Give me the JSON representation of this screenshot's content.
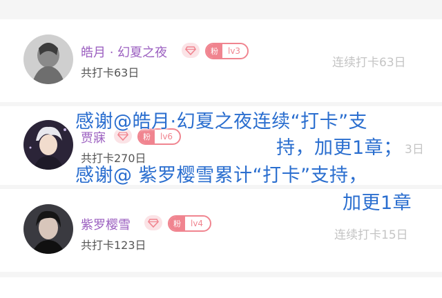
{
  "rows": [
    {
      "username": "皓月 · 幻夏之夜",
      "fan_tag": "粉",
      "level": "lv3",
      "total_checkin": "共打卡63日",
      "streak": "连续打卡63日"
    },
    {
      "username": "贾寐",
      "fan_tag": "粉",
      "level": "lv6",
      "total_checkin": "共打卡270日",
      "streak": "3日"
    },
    {
      "username": "紫罗樱雪",
      "fan_tag": "粉",
      "level": "lv4",
      "total_checkin": "共打卡123日",
      "streak": "连续打卡15日"
    }
  ],
  "overlay": {
    "line1": "感谢@皓月·幻夏之夜连续“打卡”支",
    "line2": "持，加更1章；",
    "line3": "感谢@ 紫罗樱雪累计“打卡”支持，",
    "line4": "加更1章"
  },
  "colors": {
    "username": "#9b5fc0",
    "badge": "#f0848f",
    "overlay_text": "#2a6ecf",
    "streak": "#c4c4c4"
  }
}
